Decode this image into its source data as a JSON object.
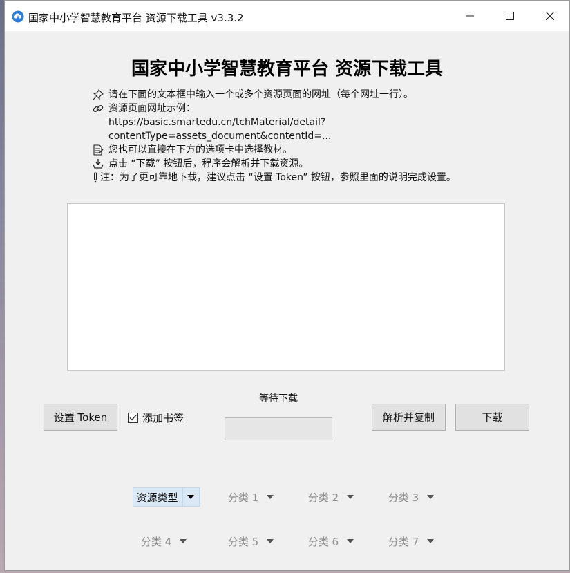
{
  "window": {
    "title": "国家中小学智慧教育平台 资源下载工具 v3.3.2",
    "minimize_label": "—",
    "maximize_label": "☐",
    "close_label": "✕"
  },
  "heading": "国家中小学智慧教育平台 资源下载工具",
  "instructions": {
    "line1": "请在下面的文本框中输入一个或多个资源页面的网址（每个网址一行）。",
    "line2": "资源页面网址示例：",
    "line3": "https://basic.smartedu.cn/tchMaterial/detail?",
    "line4": "contentType=assets_document&contentId=...",
    "line5": "您也可以直接在下方的选项卡中选择教材。",
    "line6": "点击 “下载” 按钮后，程序会解析并下载资源。",
    "line7": "注：为了更可靠地下载，建议点击 “设置 Token” 按钮，参照里面的说明完成设置。"
  },
  "url_input": {
    "value": ""
  },
  "controls": {
    "set_token_label": "设置 Token",
    "bookmark_label": "添加书签",
    "bookmark_checked": true,
    "status_text": "等待下载",
    "progress": 0,
    "parse_copy_label": "解析并复制",
    "download_label": "下载"
  },
  "tabs": {
    "resource_type": "资源类型",
    "cat1": "分类 1",
    "cat2": "分类 2",
    "cat3": "分类 3",
    "cat4": "分类 4",
    "cat5": "分类 5",
    "cat6": "分类 6",
    "cat7": "分类 7"
  },
  "icons": [
    "app-cloud-icon",
    "pushpin-icon",
    "link-icon",
    "document-icon",
    "download-icon",
    "exclamation-icon",
    "checkmark-icon",
    "dropdown-arrow-icon"
  ],
  "colors": {
    "accent": "#dbe8f6",
    "window_bg": "#f0f0f0",
    "button_bg": "#e1e1e1"
  }
}
